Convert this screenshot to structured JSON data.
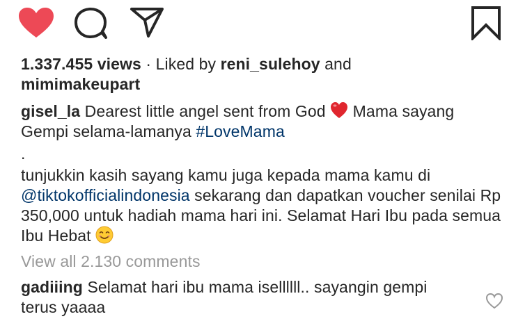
{
  "actions": {
    "like_icon": "heart-filled-icon",
    "comment_icon": "comment-bubble-icon",
    "share_icon": "paper-plane-icon",
    "save_icon": "bookmark-icon",
    "like_color": "#ED4956"
  },
  "stats": {
    "views": "1.337.455 views",
    "separator": " · Liked by ",
    "liker_one": "reni_sulehoy",
    "and": " and",
    "liker_two": "mimimakeupart"
  },
  "caption": {
    "username": "gisel_la",
    "text_part1": " Dearest little angel sent from God ",
    "heart_emoji": "red-heart-emoji",
    "text_part2": " Mama sayang Gempi selama-lamanya ",
    "hashtag": "#LoveMama",
    "dot": ".",
    "text_part3": "tunjukkin kasih sayang kamu juga kepada mama kamu di ",
    "mention": "@tiktokofficialindonesia",
    "text_part4": " sekarang dan dapatkan voucher senilai Rp 350,000 untuk hadiah mama hari ini. Selamat Hari Ibu pada semua Ibu Hebat ",
    "smile_emoji": "smiling-face-emoji"
  },
  "comments": {
    "view_all": "View all 2.130 comments",
    "items": [
      {
        "username": "gadiiing",
        "text": " Selamat hari ibu mama isellllll.. sayangin gempi terus yaaaa",
        "like_icon": "heart-outline-icon"
      }
    ]
  }
}
